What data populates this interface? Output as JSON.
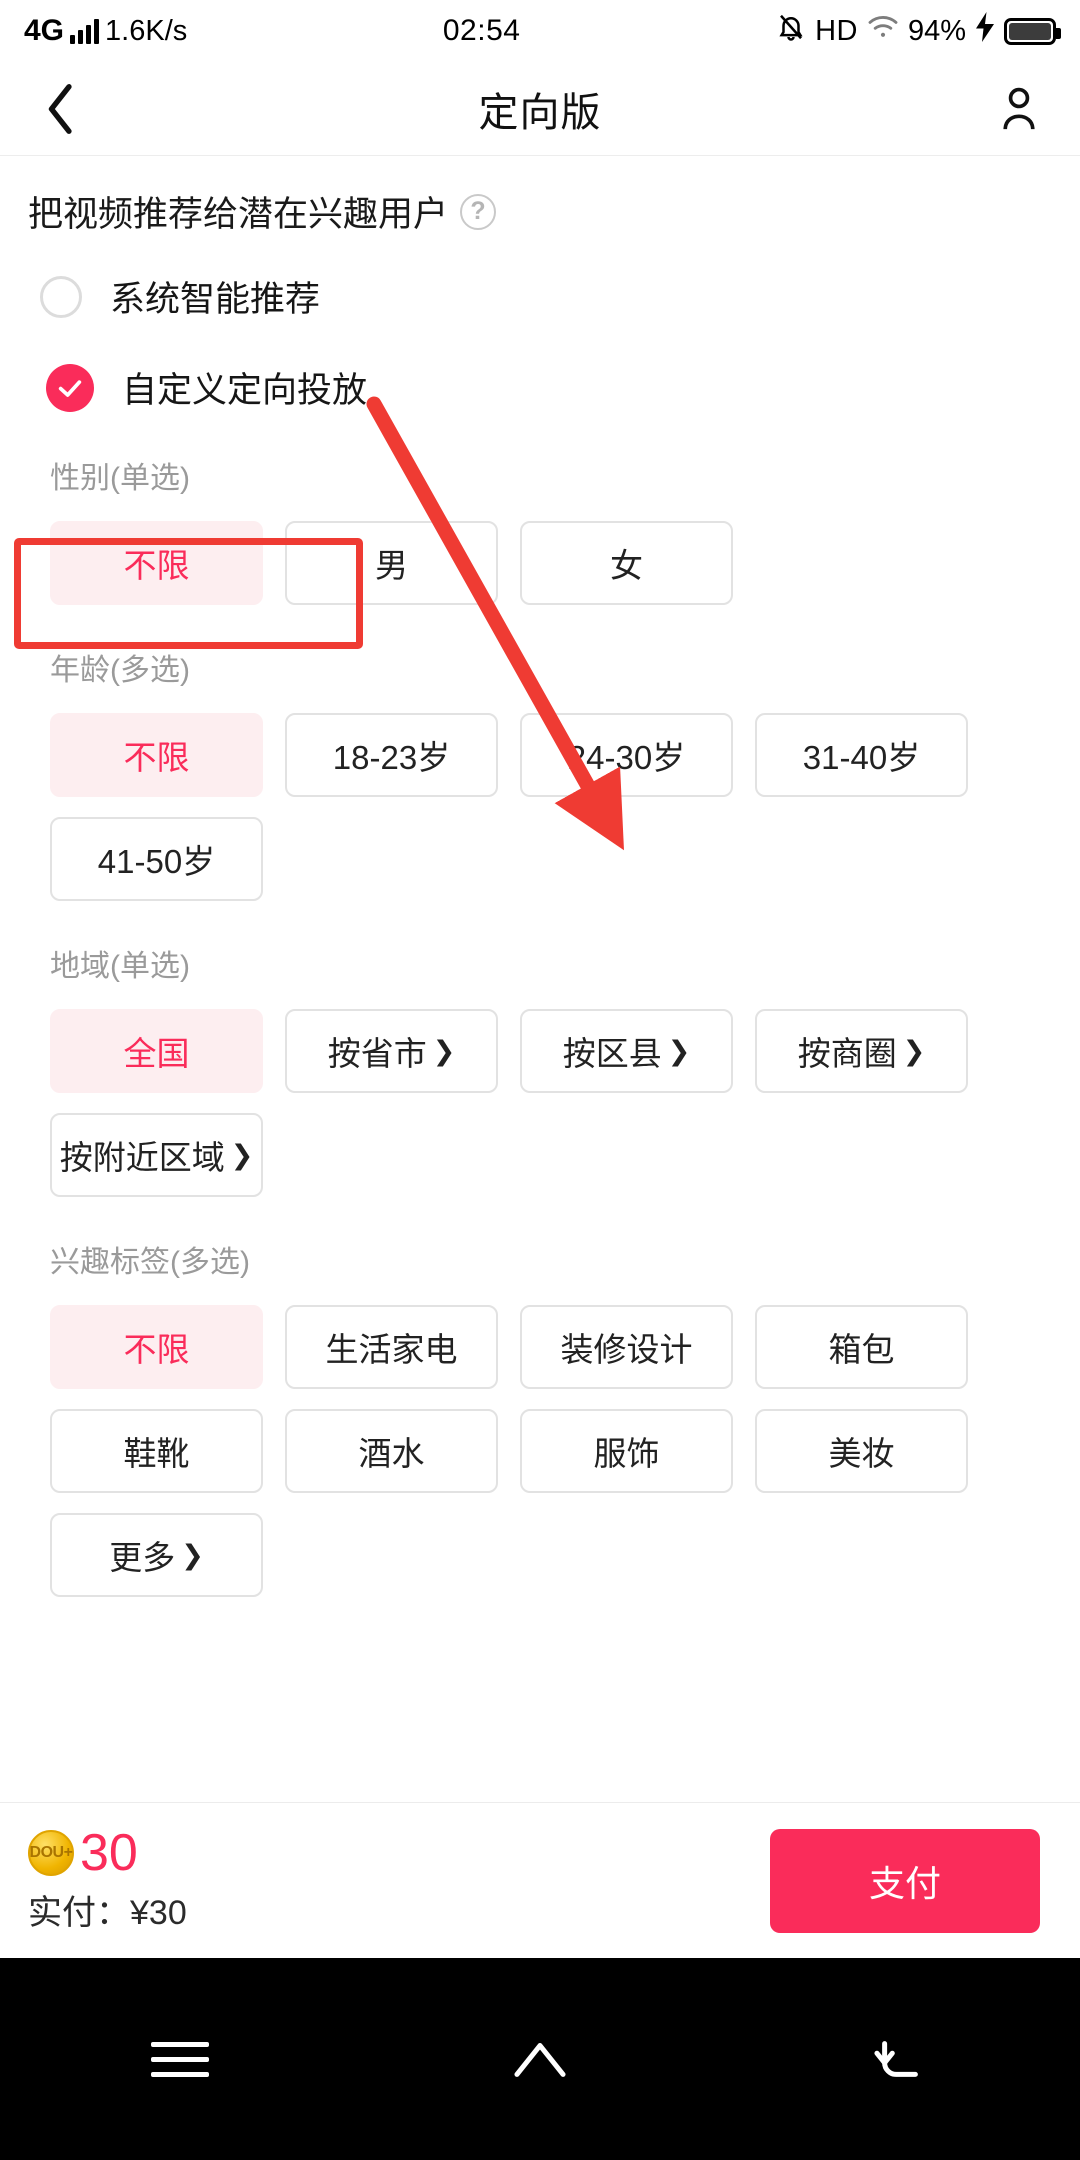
{
  "status_bar": {
    "network": "4G",
    "speed": "1.6K/s",
    "time": "02:54",
    "hd": "HD",
    "battery_percent": "94%"
  },
  "nav": {
    "title": "定向版",
    "back_icon": "back-chevron-icon",
    "account_icon": "account-person-icon"
  },
  "headline": {
    "text": "把视频推荐给潜在兴趣用户",
    "help_icon": "?"
  },
  "mode_options": [
    {
      "label": "系统智能推荐",
      "selected": false
    },
    {
      "label": "自定义定向投放",
      "selected": true
    }
  ],
  "sections": [
    {
      "title": "性别(单选)",
      "chips": [
        {
          "label": "不限",
          "selected": true,
          "chevron": false
        },
        {
          "label": "男",
          "selected": false,
          "chevron": false
        },
        {
          "label": "女",
          "selected": false,
          "chevron": false
        }
      ]
    },
    {
      "title": "年龄(多选)",
      "chips": [
        {
          "label": "不限",
          "selected": true,
          "chevron": false
        },
        {
          "label": "18-23岁",
          "selected": false,
          "chevron": false
        },
        {
          "label": "24-30岁",
          "selected": false,
          "chevron": false
        },
        {
          "label": "31-40岁",
          "selected": false,
          "chevron": false
        },
        {
          "label": "41-50岁",
          "selected": false,
          "chevron": false
        }
      ]
    },
    {
      "title": "地域(单选)",
      "chips": [
        {
          "label": "全国",
          "selected": true,
          "chevron": false
        },
        {
          "label": "按省市",
          "selected": false,
          "chevron": true
        },
        {
          "label": "按区县",
          "selected": false,
          "chevron": true
        },
        {
          "label": "按商圈",
          "selected": false,
          "chevron": true
        },
        {
          "label": "按附近区域",
          "selected": false,
          "chevron": true
        }
      ]
    },
    {
      "title": "兴趣标签(多选)",
      "chips": [
        {
          "label": "不限",
          "selected": true,
          "chevron": false
        },
        {
          "label": "生活家电",
          "selected": false,
          "chevron": false
        },
        {
          "label": "装修设计",
          "selected": false,
          "chevron": false
        },
        {
          "label": "箱包",
          "selected": false,
          "chevron": false
        },
        {
          "label": "鞋靴",
          "selected": false,
          "chevron": false
        },
        {
          "label": "酒水",
          "selected": false,
          "chevron": false
        },
        {
          "label": "服饰",
          "selected": false,
          "chevron": false
        },
        {
          "label": "美妆",
          "selected": false,
          "chevron": false
        },
        {
          "label": "更多",
          "selected": false,
          "chevron": true
        }
      ]
    }
  ],
  "pay_bar": {
    "coin_label": "DOU+",
    "coin_amount": "30",
    "actual_payment": "实付：¥30",
    "pay_button": "支付"
  },
  "android_nav": {
    "menu_icon": "menu-icon",
    "home_icon": "home-icon",
    "back_icon": "back-arrow-icon"
  },
  "colors": {
    "accent": "#fa2c5a",
    "accent_light": "#fdeef0",
    "annotation": "#ef3b33"
  }
}
